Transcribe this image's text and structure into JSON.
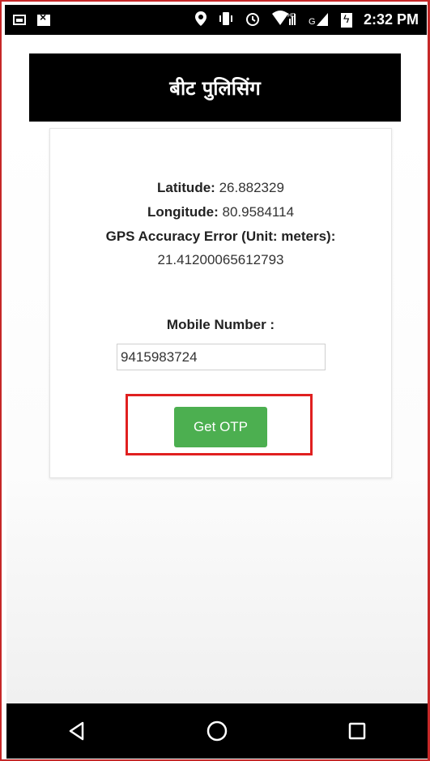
{
  "status_bar": {
    "icons": [
      "image-icon",
      "message-icon",
      "location-icon",
      "vibrate-icon",
      "alarm-icon",
      "wifi-icon",
      "signal-icon",
      "battery-icon"
    ],
    "network_hd": "HD",
    "network_g": "G",
    "time": "2:32 PM"
  },
  "app": {
    "title": "बीट पुलिसिंग"
  },
  "location": {
    "latitude_label": "Latitude:",
    "latitude_value": "26.882329",
    "longitude_label": "Longitude:",
    "longitude_value": "80.9584114",
    "accuracy_label": "GPS Accuracy Error (Unit: meters):",
    "accuracy_value": "21.41200065612793"
  },
  "form": {
    "mobile_label": "Mobile Number :",
    "mobile_value": "9415983724",
    "otp_button_label": "Get OTP"
  },
  "nav_bar": {
    "back": "back-icon",
    "home": "home-icon",
    "recents": "recents-icon"
  },
  "colors": {
    "button_green": "#4caf50",
    "highlight_red": "#e02020",
    "header_black": "#000000"
  }
}
